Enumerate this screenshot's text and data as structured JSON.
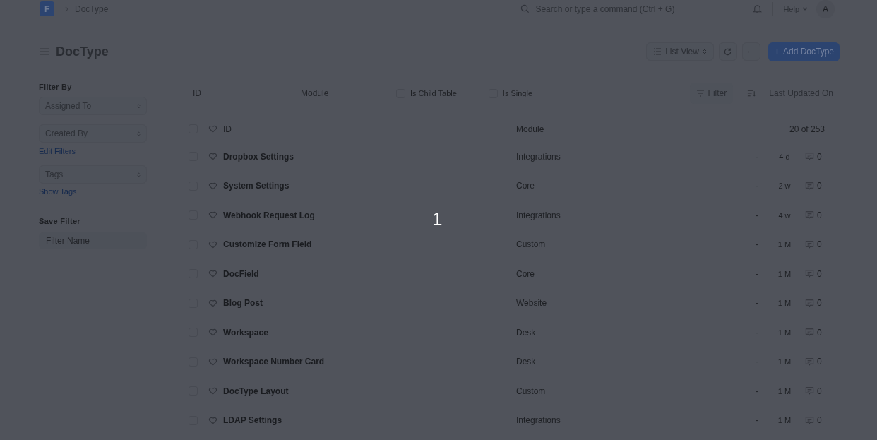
{
  "navbar": {
    "breadcrumb": "DocType",
    "search": {
      "placeholder": "Search or type a command (Ctrl + G)"
    },
    "help": "Help",
    "avatar": "A"
  },
  "page": {
    "title": "DocType",
    "view_switcher": "List View",
    "add_button": "Add DocType"
  },
  "sidebar": {
    "filter_heading": "Filter By",
    "filters": [
      "Assigned To",
      "Created By"
    ],
    "edit_filters": "Edit Filters",
    "tags": "Tags",
    "show_tags": "Show Tags",
    "save_heading": "Save Filter",
    "filter_name": {
      "placeholder": "Filter Name"
    }
  },
  "standard_filters": [
    {
      "kind": "text",
      "placeholder": "ID"
    },
    {
      "kind": "text",
      "placeholder": "Module"
    },
    {
      "kind": "check",
      "label": "Is Child Table",
      "checked": false
    },
    {
      "kind": "check",
      "label": "Is Single",
      "checked": false
    }
  ],
  "filter_button": "Filter",
  "sort_label": "Last Updated On",
  "list_header": {
    "checked": false,
    "name": "ID",
    "module": "Module",
    "count": "20 of 253"
  },
  "rows": [
    {
      "checked": false,
      "name": "Dropbox Settings",
      "module": "Integrations",
      "status": "-",
      "modified": "4 d",
      "comments": "0"
    },
    {
      "checked": false,
      "name": "System Settings",
      "module": "Core",
      "status": "-",
      "modified": "2 w",
      "comments": "0"
    },
    {
      "checked": false,
      "name": "Webhook Request Log",
      "module": "Integrations",
      "status": "-",
      "modified": "4 w",
      "comments": "0"
    },
    {
      "checked": false,
      "name": "Customize Form Field",
      "module": "Custom",
      "status": "-",
      "modified": "1 M",
      "comments": "0"
    },
    {
      "checked": false,
      "name": "DocField",
      "module": "Core",
      "status": "-",
      "modified": "1 M",
      "comments": "0"
    },
    {
      "checked": false,
      "name": "Blog Post",
      "module": "Website",
      "status": "-",
      "modified": "1 M",
      "comments": "0"
    },
    {
      "checked": false,
      "name": "Workspace",
      "module": "Desk",
      "status": "-",
      "modified": "1 M",
      "comments": "0"
    },
    {
      "checked": false,
      "name": "Workspace Number Card",
      "module": "Desk",
      "status": "-",
      "modified": "1 M",
      "comments": "0"
    },
    {
      "checked": false,
      "name": "DocType Layout",
      "module": "Custom",
      "status": "-",
      "modified": "1 M",
      "comments": "0"
    },
    {
      "checked": false,
      "name": "LDAP Settings",
      "module": "Integrations",
      "status": "-",
      "modified": "1 M",
      "comments": "0"
    }
  ],
  "step_marker": "1"
}
